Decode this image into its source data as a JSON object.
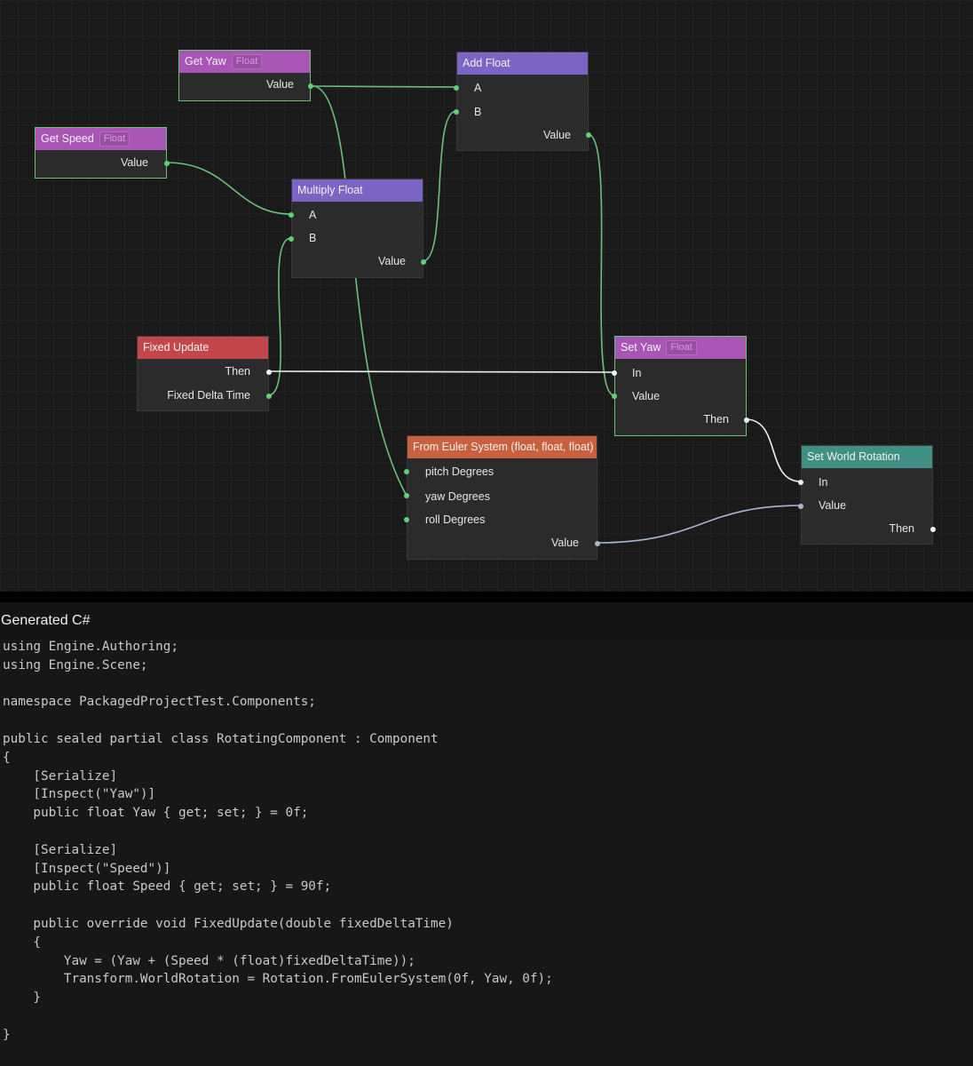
{
  "graph": {
    "nodes": {
      "get_yaw": {
        "title": "Get Yaw",
        "tag": "Float",
        "value_label": "Value"
      },
      "get_speed": {
        "title": "Get Speed",
        "tag": "Float",
        "value_label": "Value"
      },
      "add_float": {
        "title": "Add Float",
        "pin_a": "A",
        "pin_b": "B",
        "value_label": "Value"
      },
      "multiply_float": {
        "title": "Multiply Float",
        "pin_a": "A",
        "pin_b": "B",
        "value_label": "Value"
      },
      "fixed_update": {
        "title": "Fixed Update",
        "then_label": "Then",
        "delta_label": "Fixed Delta Time"
      },
      "set_yaw": {
        "title": "Set Yaw",
        "tag": "Float",
        "in_label": "In",
        "value_label": "Value",
        "then_label": "Then"
      },
      "from_euler": {
        "title": "From Euler System (float, float, float)",
        "pitch_label": "pitch Degrees",
        "yaw_label": "yaw Degrees",
        "roll_label": "roll Degrees",
        "value_label": "Value"
      },
      "set_world_rotation": {
        "title": "Set World Rotation",
        "in_label": "In",
        "value_label": "Value",
        "then_label": "Then"
      }
    },
    "colors": {
      "variable_header": "#a955b5",
      "math_header": "#7b64c4",
      "event_header": "#c3474a",
      "euler_header": "#c9603f",
      "action_header": "#3f8f84",
      "data_wire": "#6cc07c",
      "exec_wire": "#f0f0f0",
      "rotation_wire": "#a9b6d0"
    }
  },
  "code": {
    "title": "Generated C#",
    "lines": [
      "using Engine.Authoring;",
      "using Engine.Scene;",
      "",
      "namespace PackagedProjectTest.Components;",
      "",
      "public sealed partial class RotatingComponent : Component",
      "{",
      "    [Serialize]",
      "    [Inspect(\"Yaw\")]",
      "    public float Yaw { get; set; } = 0f;",
      "",
      "    [Serialize]",
      "    [Inspect(\"Speed\")]",
      "    public float Speed { get; set; } = 90f;",
      "",
      "    public override void FixedUpdate(double fixedDeltaTime)",
      "    {",
      "        Yaw = (Yaw + (Speed * (float)fixedDeltaTime));",
      "        Transform.WorldRotation = Rotation.FromEulerSystem(0f, Yaw, 0f);",
      "    }",
      "",
      "}"
    ]
  }
}
